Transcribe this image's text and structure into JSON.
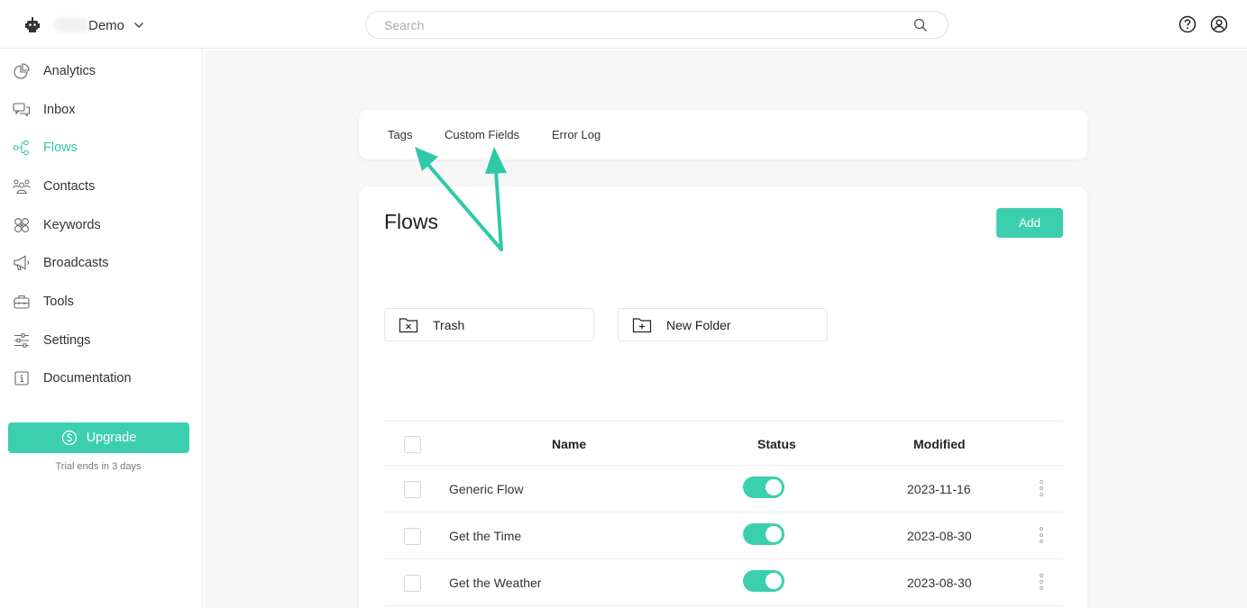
{
  "topbar": {
    "workspace_name": "Demo",
    "search_placeholder": "Search"
  },
  "sidebar": {
    "items": [
      {
        "label": "Analytics",
        "icon": "pie-chart-icon"
      },
      {
        "label": "Inbox",
        "icon": "chat-bubbles-icon"
      },
      {
        "label": "Flows",
        "icon": "flow-nodes-icon",
        "active": true
      },
      {
        "label": "Contacts",
        "icon": "people-icon"
      },
      {
        "label": "Keywords",
        "icon": "keywords-icon"
      },
      {
        "label": "Broadcasts",
        "icon": "megaphone-icon"
      },
      {
        "label": "Tools",
        "icon": "toolbox-icon"
      },
      {
        "label": "Settings",
        "icon": "sliders-icon"
      },
      {
        "label": "Documentation",
        "icon": "info-box-icon"
      }
    ],
    "upgrade_label": "Upgrade",
    "trial_text": "Trial ends in 3 days"
  },
  "tabs": [
    "Tags",
    "Custom Fields",
    "Error Log"
  ],
  "flows": {
    "title": "Flows",
    "add_label": "Add",
    "folders": [
      {
        "label": "Trash",
        "icon": "folder-x-icon"
      },
      {
        "label": "New Folder",
        "icon": "folder-plus-icon"
      }
    ],
    "columns": {
      "name": "Name",
      "status": "Status",
      "modified": "Modified"
    },
    "rows": [
      {
        "name": "Generic Flow",
        "status": true,
        "modified": "2023-11-16"
      },
      {
        "name": "Get the Time",
        "status": true,
        "modified": "2023-08-30"
      },
      {
        "name": "Get the Weather",
        "status": true,
        "modified": "2023-08-30"
      }
    ]
  },
  "colors": {
    "accent": "#3ccfae",
    "annotation_arrow": "#2ec9a6"
  }
}
